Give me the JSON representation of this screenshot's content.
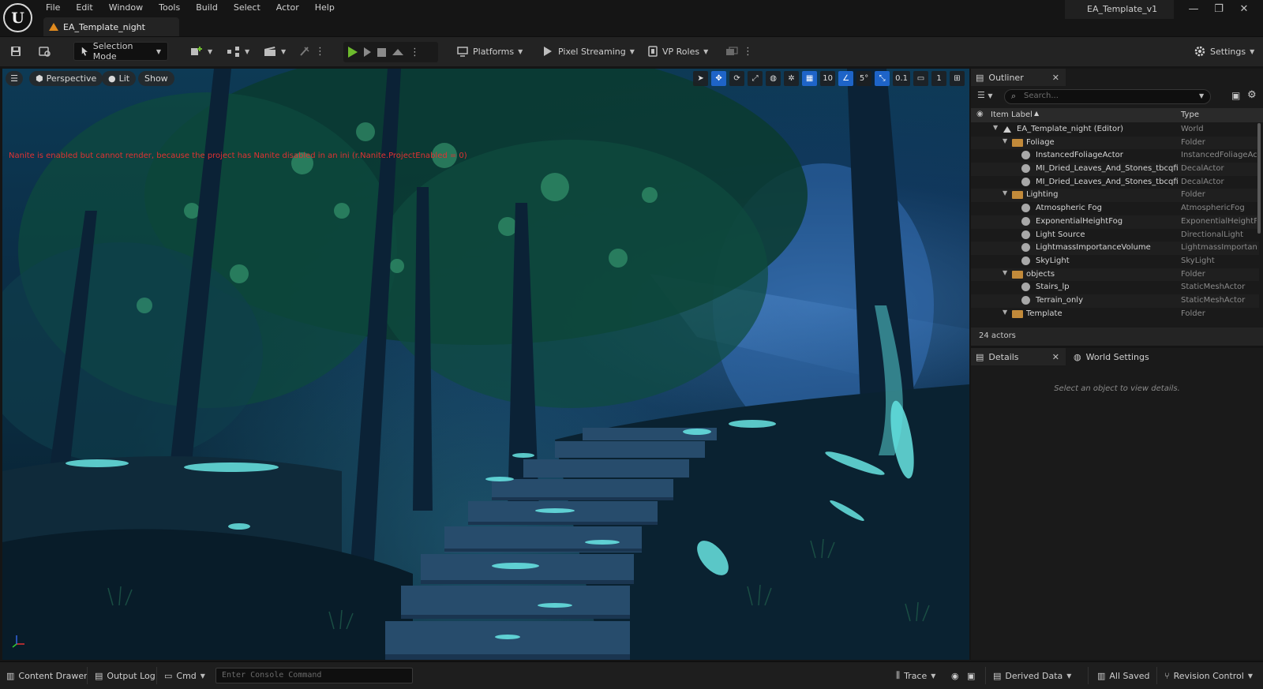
{
  "app": {
    "project_name": "EA_Template_v1",
    "document_tab": "EA_Template_night"
  },
  "menu": [
    "File",
    "Edit",
    "Window",
    "Tools",
    "Build",
    "Select",
    "Actor",
    "Help"
  ],
  "window_controls": {
    "minimize": "—",
    "restore": "❐",
    "close": "✕"
  },
  "toolbar": {
    "selection_mode": "Selection Mode",
    "platforms": "Platforms",
    "pixel_streaming": "Pixel Streaming",
    "vp_roles": "VP Roles",
    "settings": "Settings"
  },
  "viewport": {
    "view_mode": "Perspective",
    "lighting": "Lit",
    "show": "Show",
    "grid_snap": "10",
    "rotation_snap": "5°",
    "scale_snap": "0.1",
    "camera_speed": "1",
    "warning": "Nanite is enabled but cannot render, because the project has Nanite disabled in an ini (r.Nanite.ProjectEnabled = 0)"
  },
  "outliner": {
    "tab_label": "Outliner",
    "search_placeholder": "Search...",
    "col_label": "Item Label",
    "col_type": "Type",
    "rows": [
      {
        "label": "EA_Template_night (Editor)",
        "type": "World",
        "depth": 0,
        "kind": "world"
      },
      {
        "label": "Foliage",
        "type": "Folder",
        "depth": 1,
        "kind": "folder"
      },
      {
        "label": "InstancedFoliageActor",
        "type": "InstancedFoliageActor",
        "depth": 2,
        "kind": "actor"
      },
      {
        "label": "MI_Dried_Leaves_And_Stones_tbcqfic",
        "type": "DecalActor",
        "depth": 2,
        "kind": "actor"
      },
      {
        "label": "MI_Dried_Leaves_And_Stones_tbcqfic",
        "type": "DecalActor",
        "depth": 2,
        "kind": "actor"
      },
      {
        "label": "Lighting",
        "type": "Folder",
        "depth": 1,
        "kind": "folder"
      },
      {
        "label": "Atmospheric Fog",
        "type": "AtmosphericFog",
        "depth": 2,
        "kind": "actor"
      },
      {
        "label": "ExponentialHeightFog",
        "type": "ExponentialHeightFog",
        "depth": 2,
        "kind": "actor"
      },
      {
        "label": "Light Source",
        "type": "DirectionalLight",
        "depth": 2,
        "kind": "actor"
      },
      {
        "label": "LightmassImportanceVolume",
        "type": "LightmassImportanceVolume",
        "depth": 2,
        "kind": "actor"
      },
      {
        "label": "SkyLight",
        "type": "SkyLight",
        "depth": 2,
        "kind": "actor"
      },
      {
        "label": "objects",
        "type": "Folder",
        "depth": 1,
        "kind": "folder"
      },
      {
        "label": "Stairs_lp",
        "type": "StaticMeshActor",
        "depth": 2,
        "kind": "actor"
      },
      {
        "label": "Terrain_only",
        "type": "StaticMeshActor",
        "depth": 2,
        "kind": "actor"
      },
      {
        "label": "Template",
        "type": "Folder",
        "depth": 1,
        "kind": "folder"
      }
    ],
    "actor_count": "24 actors"
  },
  "details": {
    "tab_label": "Details",
    "world_settings_label": "World Settings",
    "empty_message": "Select an object to view details."
  },
  "statusbar": {
    "content_drawer": "Content Drawer",
    "output_log": "Output Log",
    "cmd": "Cmd",
    "console_placeholder": "Enter Console Command",
    "trace": "Trace",
    "derived_data": "Derived Data",
    "all_saved": "All Saved",
    "revision_control": "Revision Control"
  }
}
